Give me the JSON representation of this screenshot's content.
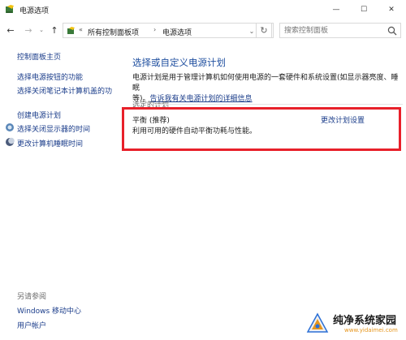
{
  "window": {
    "title": "电源选项",
    "min_glyph": "—",
    "max_glyph": "☐",
    "close_glyph": "✕"
  },
  "nav": {
    "back_glyph": "←",
    "forward_glyph": "→",
    "recent_glyph": "⌄",
    "up_glyph": "↑",
    "address": {
      "prefix": "«",
      "crumbs": [
        "所有控制面板项",
        "电源选项"
      ],
      "sep": "›",
      "dropdown_glyph": "⌄",
      "refresh_glyph": "↻"
    },
    "search": {
      "placeholder": "搜索控制面板"
    }
  },
  "sidebar": {
    "home": "控制面板主页",
    "links": [
      {
        "label": "选择电源按钮的功能",
        "icon": ""
      },
      {
        "label": "选择关闭笔记本计算机盖的功",
        "icon": ""
      },
      {
        "label": "创建电源计划",
        "icon": ""
      },
      {
        "label": "选择关闭显示器的时间",
        "icon": "display-power-icon"
      },
      {
        "label": "更改计算机睡眠时间",
        "icon": "moon-sleep-icon"
      }
    ],
    "see_also": "另请参阅",
    "see_also_links": [
      "Windows 移动中心",
      "用户帐户"
    ]
  },
  "main": {
    "title": "选择或自定义电源计划",
    "description_line1": "电源计划是用于管理计算机如何使用电源的一套硬件和系统设置(如显示器亮度、睡眠",
    "description_line2_prefix": "等)。",
    "description_link": "告诉我有关电源计划的详细信息",
    "section_label": "选定的计划",
    "plan": {
      "name": "平衡 (推荐)",
      "description": "利用可用的硬件自动平衡功耗与性能。",
      "change_link": "更改计划设置"
    },
    "highlight_color": "#e8202a"
  },
  "watermark": {
    "text": "纯净系统家园",
    "url": "www.yidaimei.com"
  },
  "colors": {
    "link": "#1a3c8a",
    "title": "#1e4e9f",
    "highlight": "#e8202a",
    "watermark_accent": "#e6961e"
  }
}
